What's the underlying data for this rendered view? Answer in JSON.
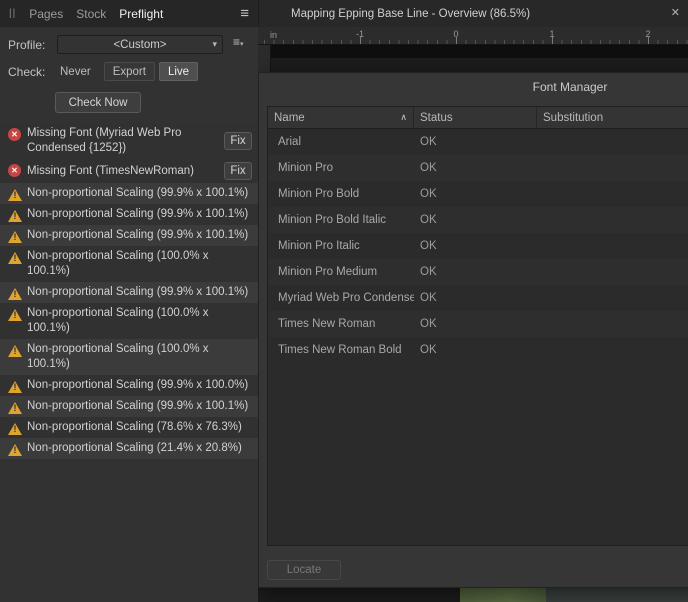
{
  "icons": {
    "grip": "||",
    "hamburger": "≡",
    "preset_menu": "≡",
    "dropdown_arrow": "▾",
    "close": "✕",
    "sort_asc": "∧",
    "error_mark": "✕",
    "warning_mark": "!"
  },
  "colors": {
    "error": "#c94444",
    "warning": "#dfa32f",
    "panel_bg": "#323232",
    "dialog_bg": "#363636"
  },
  "left_panel": {
    "tabs": [
      {
        "label": "Pages",
        "active": false
      },
      {
        "label": "Stock",
        "active": false
      },
      {
        "label": "Preflight",
        "active": true
      }
    ],
    "profile": {
      "label": "Profile:",
      "value": "<Custom>"
    },
    "check": {
      "label": "Check:",
      "options": [
        "Never",
        "Export",
        "Live"
      ],
      "selected": "Live"
    },
    "check_now_label": "Check Now",
    "fix_label": "Fix",
    "issues": [
      {
        "type": "error",
        "text": "Missing Font (Myriad Web Pro Condensed {1252})",
        "fix": true
      },
      {
        "type": "error",
        "text": "Missing Font (TimesNewRoman)",
        "fix": true
      },
      {
        "type": "warning",
        "text": "Non-proportional Scaling (99.9% x 100.1%)",
        "fix": false
      },
      {
        "type": "warning",
        "text": "Non-proportional Scaling (99.9% x 100.1%)",
        "fix": false
      },
      {
        "type": "warning",
        "text": "Non-proportional Scaling (99.9% x 100.1%)",
        "fix": false
      },
      {
        "type": "warning",
        "text": "Non-proportional Scaling (100.0% x 100.1%)",
        "fix": false
      },
      {
        "type": "warning",
        "text": "Non-proportional Scaling (99.9% x 100.1%)",
        "fix": false
      },
      {
        "type": "warning",
        "text": "Non-proportional Scaling (100.0% x 100.1%)",
        "fix": false
      },
      {
        "type": "warning",
        "text": "Non-proportional Scaling (100.0% x 100.1%)",
        "fix": false
      },
      {
        "type": "warning",
        "text": "Non-proportional Scaling (99.9% x 100.0%)",
        "fix": false
      },
      {
        "type": "warning",
        "text": "Non-proportional Scaling (99.9% x 100.1%)",
        "fix": false
      },
      {
        "type": "warning",
        "text": "Non-proportional Scaling (78.6% x 76.3%)",
        "fix": false
      },
      {
        "type": "warning",
        "text": "Non-proportional Scaling (21.4% x 20.8%)",
        "fix": false
      }
    ]
  },
  "document": {
    "tab_title": "Mapping Epping Base Line - Overview (86.5%)",
    "ruler": {
      "unit": "in",
      "ticks": [
        "-1",
        "0",
        "1",
        "2"
      ]
    }
  },
  "font_manager": {
    "title": "Font Manager",
    "columns": [
      "Name",
      "Status",
      "Substitution"
    ],
    "rows": [
      {
        "name": "Arial",
        "status": "OK",
        "substitution": ""
      },
      {
        "name": "Minion Pro",
        "status": "OK",
        "substitution": ""
      },
      {
        "name": "Minion Pro Bold",
        "status": "OK",
        "substitution": ""
      },
      {
        "name": "Minion Pro Bold Italic",
        "status": "OK",
        "substitution": ""
      },
      {
        "name": "Minion Pro Italic",
        "status": "OK",
        "substitution": ""
      },
      {
        "name": "Minion Pro Medium",
        "status": "OK",
        "substitution": ""
      },
      {
        "name": "Myriad Web Pro Condense",
        "status": "OK",
        "substitution": ""
      },
      {
        "name": "Times New Roman",
        "status": "OK",
        "substitution": ""
      },
      {
        "name": "Times New Roman Bold",
        "status": "OK",
        "substitution": ""
      }
    ],
    "locate_label": "Locate"
  }
}
